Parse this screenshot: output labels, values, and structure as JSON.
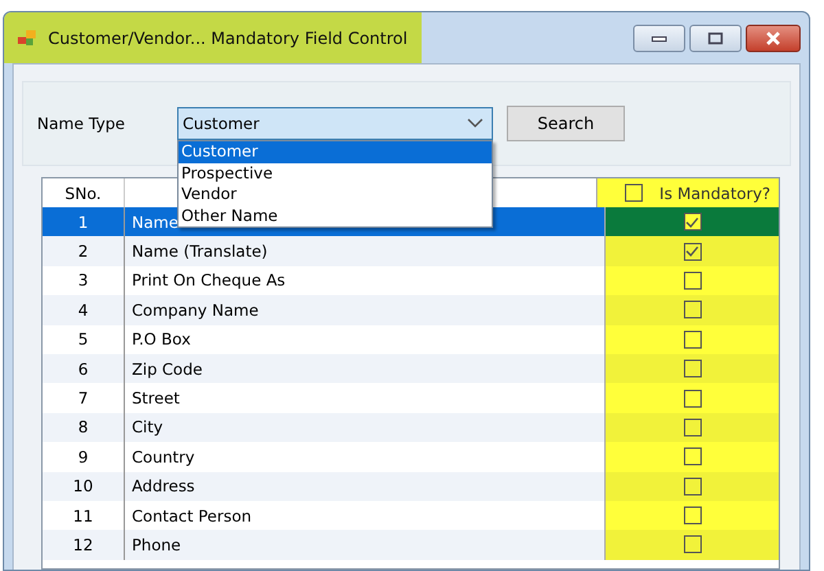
{
  "window": {
    "title": "Customer/Vendor... Mandatory Field Control",
    "title_highlighted": true
  },
  "filter": {
    "label": "Name Type",
    "value": "Customer",
    "expanded": true,
    "options": [
      {
        "label": "Customer",
        "selected": true
      },
      {
        "label": "Prospective",
        "selected": false
      },
      {
        "label": "Vendor",
        "selected": false
      },
      {
        "label": "Other Name",
        "selected": false
      }
    ]
  },
  "search_button": "Search",
  "table": {
    "columns": [
      "SNo.",
      "Is Mandatory?"
    ],
    "select_all_checked": false,
    "mandatory_highlighted": true,
    "rows": [
      {
        "sno": "1",
        "field": "Name",
        "mandatory": true,
        "selected": true
      },
      {
        "sno": "2",
        "field": "Name (Translate)",
        "mandatory": true,
        "selected": false
      },
      {
        "sno": "3",
        "field": "Print On Cheque As",
        "mandatory": false,
        "selected": false
      },
      {
        "sno": "4",
        "field": "Company Name",
        "mandatory": false,
        "selected": false
      },
      {
        "sno": "5",
        "field": "P.O Box",
        "mandatory": false,
        "selected": false
      },
      {
        "sno": "6",
        "field": "Zip Code",
        "mandatory": false,
        "selected": false
      },
      {
        "sno": "7",
        "field": "Street",
        "mandatory": false,
        "selected": false
      },
      {
        "sno": "8",
        "field": "City",
        "mandatory": false,
        "selected": false
      },
      {
        "sno": "9",
        "field": "Country",
        "mandatory": false,
        "selected": false
      },
      {
        "sno": "10",
        "field": "Address",
        "mandatory": false,
        "selected": false
      },
      {
        "sno": "11",
        "field": "Contact Person",
        "mandatory": false,
        "selected": false
      },
      {
        "sno": "12",
        "field": "Phone",
        "mandatory": false,
        "selected": false
      }
    ]
  }
}
